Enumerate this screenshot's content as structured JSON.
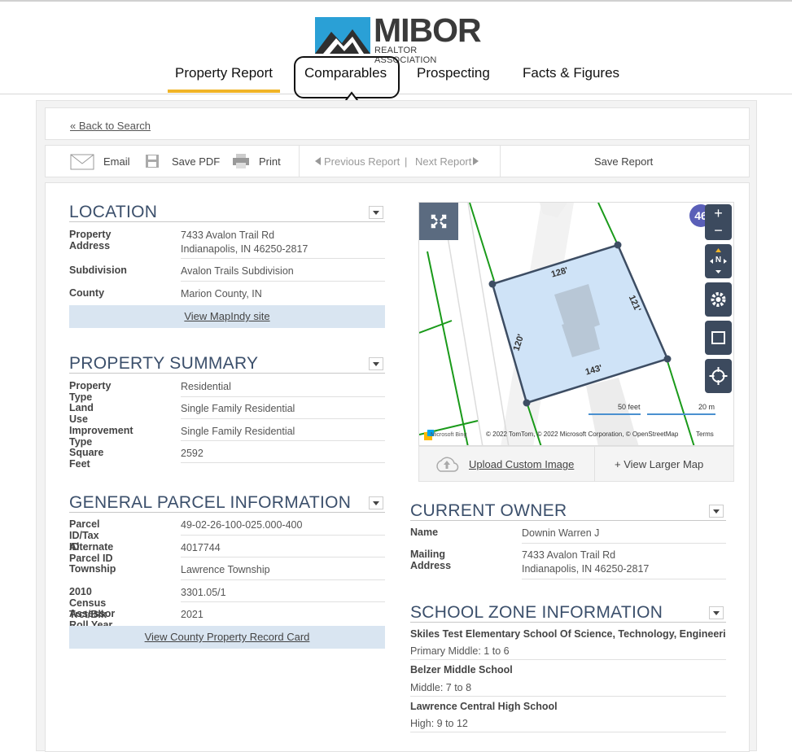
{
  "logo": {
    "brand": "MIBOR",
    "subtitle": "REALTOR ASSOCIATION"
  },
  "nav": {
    "tabs": [
      "Property Report",
      "Comparables",
      "Prospecting",
      "Facts & Figures"
    ],
    "active": "Property Report"
  },
  "back_link": "« Back to Search",
  "toolbar": {
    "email": "Email",
    "save_pdf": "Save PDF",
    "print": "Print",
    "previous": "Previous Report",
    "divider": "|",
    "next": "Next Report",
    "save_report": "Save Report"
  },
  "location": {
    "title": "LOCATION",
    "rows": [
      {
        "label": "Property Address",
        "line1": "7433 Avalon Trail Rd",
        "line2": "Indianapolis, IN 46250-2817"
      },
      {
        "label": "Subdivision",
        "value": "Avalon Trails Subdivision"
      },
      {
        "label": "County",
        "value": "Marion County, IN"
      }
    ],
    "link": "View MapIndy site"
  },
  "summary": {
    "title": "PROPERTY SUMMARY",
    "rows": [
      {
        "label": "Property Type",
        "value": "Residential"
      },
      {
        "label": "Land Use",
        "value": "Single Family Residential"
      },
      {
        "label": "Improvement Type",
        "value": "Single Family Residential"
      },
      {
        "label": "Square Feet",
        "value": "2592"
      }
    ]
  },
  "parcel": {
    "title": "GENERAL PARCEL INFORMATION",
    "rows": [
      {
        "label": "Parcel ID/Tax ID",
        "value": "49-02-26-100-025.000-400"
      },
      {
        "label": "Alternate Parcel ID",
        "value": "4017744"
      },
      {
        "label": "Township",
        "value": "Lawrence Township"
      },
      {
        "label": "2010 Census Trct/Blk",
        "value": "3301.05/1"
      },
      {
        "label": "Assessor Roll Year",
        "value": "2021"
      }
    ],
    "link": "View County Property Record Card"
  },
  "map": {
    "dims": [
      "128'",
      "121'",
      "120'",
      "143'"
    ],
    "scale_feet": "50 feet",
    "scale_m": "20 m",
    "provider": "Microsoft Bing",
    "attribution": "© 2022 TomTom, © 2022 Microsoft Corporation, © OpenStreetMap",
    "terms": "Terms",
    "shield": "46",
    "upload": "Upload Custom Image",
    "larger": "+ View Larger Map",
    "compass": "N",
    "colors": {
      "parcel_fill": "#cfe3f7",
      "parcel_stroke": "#3d4d63",
      "lot_lines": "#1a9a1a",
      "controls": "#3c4a5e"
    }
  },
  "owner": {
    "title": "CURRENT OWNER",
    "rows": [
      {
        "label": "Name",
        "value": "Downin Warren J"
      },
      {
        "label": "Mailing Address",
        "line1": "7433 Avalon Trail Rd",
        "line2": "Indianapolis, IN 46250-2817"
      }
    ]
  },
  "schools": {
    "title": "SCHOOL ZONE INFORMATION",
    "items": [
      {
        "name": "Skiles Test Elementary School Of Science, Technology, Engineerin",
        "grades": "Primary Middle: 1 to 6"
      },
      {
        "name": "Belzer Middle School",
        "grades": "Middle: 7 to 8"
      },
      {
        "name": "Lawrence Central High School",
        "grades": "High: 9 to 12"
      }
    ]
  }
}
